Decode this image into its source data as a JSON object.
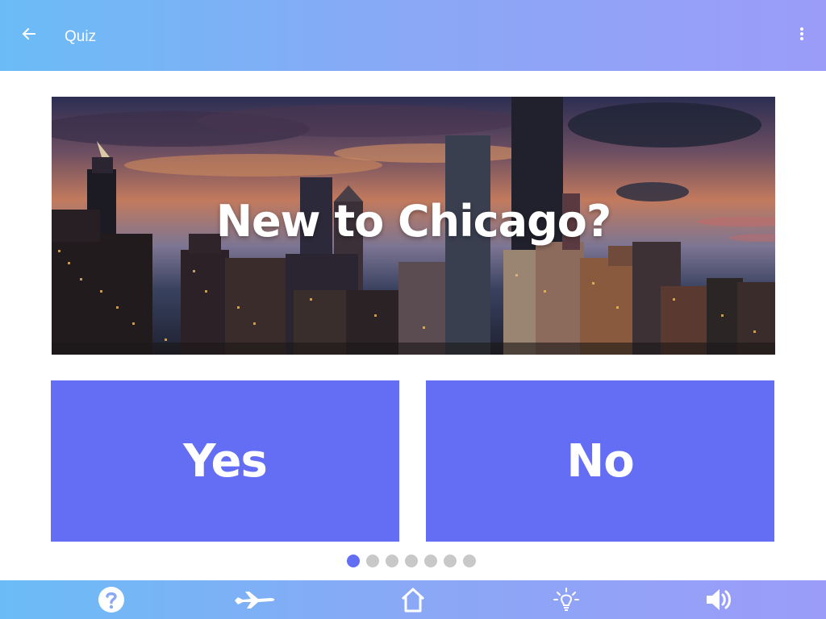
{
  "appbar": {
    "title": "Quiz",
    "back_icon": "arrow-left-icon",
    "menu_icon": "more-vertical-icon"
  },
  "hero": {
    "title": "New to Chicago?",
    "image": "chicago-skyline-sunset"
  },
  "answers": {
    "yes_label": "Yes",
    "no_label": "No",
    "color": "#646ef5"
  },
  "pager": {
    "total": 7,
    "active_index": 0,
    "active_color": "#646ef5",
    "inactive_color": "#c8c8c8"
  },
  "bottom_nav": {
    "items": [
      {
        "icon": "help-circle-icon"
      },
      {
        "icon": "airplane-icon"
      },
      {
        "icon": "home-icon"
      },
      {
        "icon": "lightbulb-icon"
      },
      {
        "icon": "speaker-icon"
      }
    ]
  },
  "colors": {
    "bar_gradient_start": "#6bbcf6",
    "bar_gradient_end": "#9b9cf8"
  }
}
